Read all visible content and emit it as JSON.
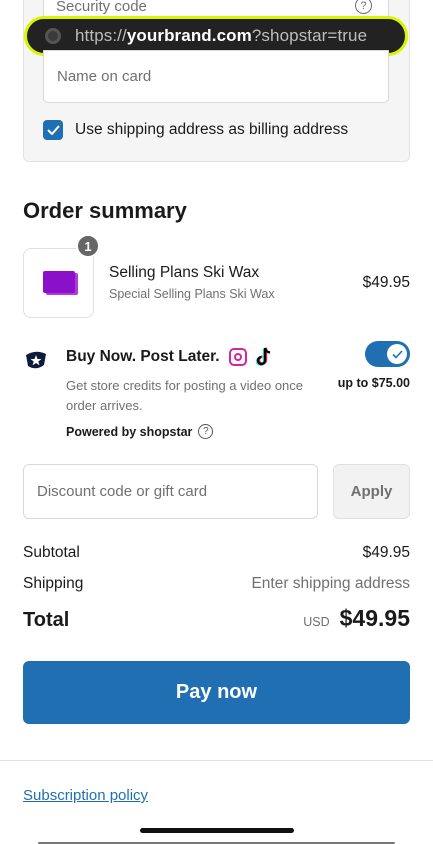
{
  "browser": {
    "url_prefix": "https://",
    "url_host": "yourbrand.com",
    "url_query": "?shopstar=true"
  },
  "payment": {
    "security_code_label": "Security code",
    "security_help": "?",
    "name_on_card_placeholder": "Name on card",
    "billing_checkbox_label": "Use shipping address as billing address",
    "billing_checked": true
  },
  "order_summary": {
    "title": "Order summary",
    "product": {
      "quantity": "1",
      "name": "Selling Plans Ski Wax",
      "subtitle": "Special Selling Plans Ski Wax",
      "price": "$49.95"
    }
  },
  "shopstar": {
    "title": "Buy Now. Post Later.",
    "description": "Get store credits for posting a video once order arrives.",
    "amount": "up to $75.00",
    "powered_by": "Powered by shopstar",
    "help": "?",
    "toggle_on": true
  },
  "discount": {
    "placeholder": "Discount code or gift card",
    "apply_label": "Apply"
  },
  "totals": {
    "subtotal_label": "Subtotal",
    "subtotal_value": "$49.95",
    "shipping_label": "Shipping",
    "shipping_value": "Enter shipping address",
    "total_label": "Total",
    "currency": "USD",
    "total_value": "$49.95"
  },
  "pay_button_label": "Pay now",
  "footer": {
    "subscription_policy": "Subscription policy"
  },
  "colors": {
    "accent": "#1f6fb2",
    "url_highlight": "#d9f500"
  }
}
